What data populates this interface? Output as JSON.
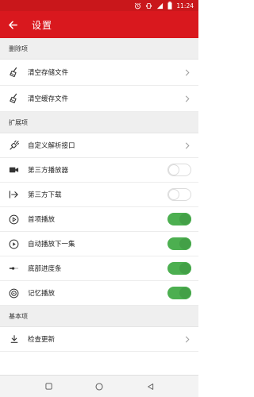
{
  "status_bar": {
    "time": "11:24",
    "icons": [
      "alarm-icon",
      "vibrate-icon",
      "signal-icon",
      "battery-icon"
    ]
  },
  "app_bar": {
    "title": "设置",
    "back_icon": "arrow-left-icon"
  },
  "sections": {
    "delete": {
      "header": "删除项",
      "items": [
        {
          "label": "清空存储文件",
          "icon": "broom-icon"
        },
        {
          "label": "清空缓存文件",
          "icon": "broom-icon"
        }
      ]
    },
    "extend": {
      "header": "扩展项",
      "items": [
        {
          "label": "自定义解析接口",
          "icon": "plug-icon",
          "control": "chevron"
        },
        {
          "label": "第三方播放器",
          "icon": "video-camera-icon",
          "control": "toggle",
          "on": false
        },
        {
          "label": "第三方下载",
          "icon": "download-arrow-icon",
          "control": "toggle",
          "on": false
        },
        {
          "label": "首项播放",
          "icon": "play-circle-icon",
          "control": "toggle",
          "on": true
        },
        {
          "label": "自动播放下一集",
          "icon": "play-circle-filled-icon",
          "control": "toggle",
          "on": true
        },
        {
          "label": "底部进度条",
          "icon": "progress-bar-icon",
          "control": "toggle",
          "on": true
        },
        {
          "label": "记忆播放",
          "icon": "memory-icon",
          "control": "toggle",
          "on": true
        }
      ]
    },
    "basic": {
      "header": "基本项",
      "items": [
        {
          "label": "检查更新",
          "icon": "update-download-icon",
          "control": "chevron"
        }
      ]
    }
  },
  "nav_bar": {
    "buttons": [
      "recent-apps-icon",
      "home-icon",
      "back-triangle-icon"
    ]
  },
  "colors": {
    "primary": "#d9181e",
    "status_bar": "#c9171b",
    "toggle_on": "#4caf50"
  }
}
